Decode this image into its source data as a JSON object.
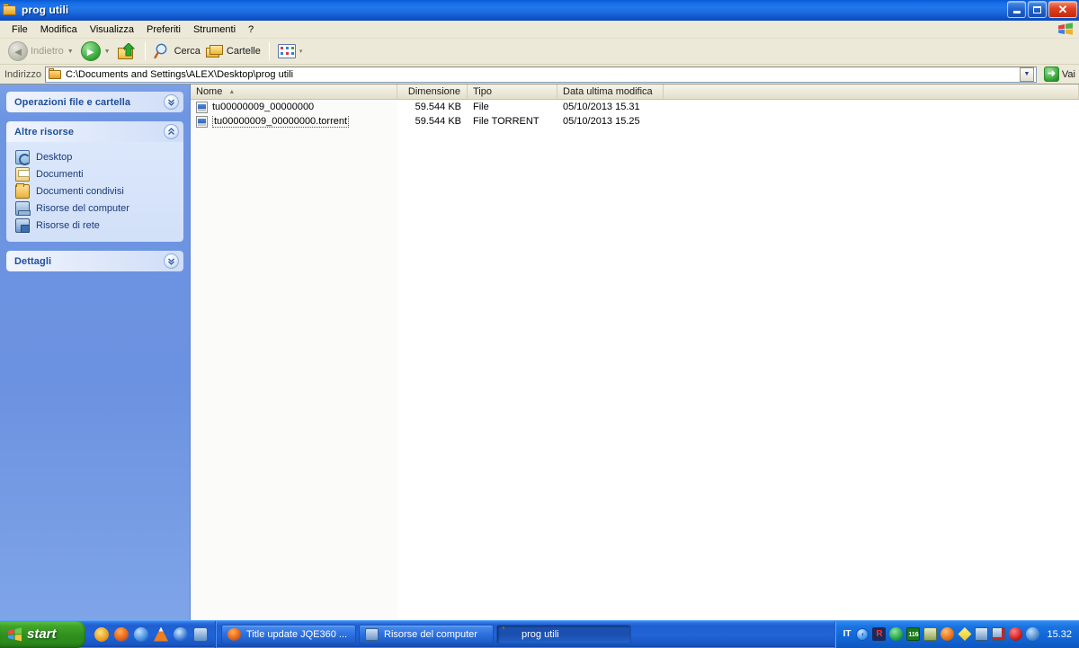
{
  "window": {
    "title": "prog utili",
    "title_icon": "folder-icon",
    "controls": {
      "minimize": "_",
      "maximize": "❐",
      "close": "✕"
    }
  },
  "menu": {
    "items": [
      {
        "label": "File"
      },
      {
        "label": "Modifica"
      },
      {
        "label": "Visualizza"
      },
      {
        "label": "Preferiti"
      },
      {
        "label": "Strumenti"
      },
      {
        "label": "?"
      }
    ],
    "right_logo": "windows-flag-icon"
  },
  "toolbar": {
    "back": {
      "label": "Indietro",
      "icon": "back-arrow-icon",
      "enabled": false
    },
    "forward": {
      "label": "",
      "icon": "forward-arrow-icon",
      "enabled": true
    },
    "up": {
      "label": "",
      "icon": "up-folder-icon"
    },
    "search": {
      "label": "Cerca",
      "icon": "magnifier-icon"
    },
    "folders": {
      "label": "Cartelle",
      "icon": "folders-icon"
    },
    "views": {
      "label": "",
      "icon": "views-grid-icon"
    },
    "dropdown_arrow": "▾"
  },
  "address": {
    "label": "Indirizzo",
    "icon": "folder-icon",
    "value": "C:\\Documents and Settings\\ALEX\\Desktop\\prog utili",
    "dropdown_icon": "chevron-down-icon",
    "go_label": "Vai",
    "go_icon": "go-arrow-icon"
  },
  "sidebar": {
    "panels": [
      {
        "title": "Operazioni file e cartella",
        "collapsed": true,
        "chevron": "⌄⌄",
        "items": []
      },
      {
        "title": "Altre risorse",
        "collapsed": false,
        "chevron": "⌃⌃",
        "items": [
          {
            "label": "Desktop",
            "icon": "desktop-icon"
          },
          {
            "label": "Documenti",
            "icon": "documents-icon"
          },
          {
            "label": "Documenti condivisi",
            "icon": "shared-documents-icon"
          },
          {
            "label": "Risorse del computer",
            "icon": "my-computer-icon"
          },
          {
            "label": "Risorse di rete",
            "icon": "network-places-icon"
          }
        ]
      },
      {
        "title": "Dettagli",
        "collapsed": true,
        "chevron": "⌄⌄",
        "items": []
      }
    ]
  },
  "filelist": {
    "columns": [
      {
        "key": "name",
        "label": "Nome",
        "sorted": true,
        "sort_arrow": "▲"
      },
      {
        "key": "size",
        "label": "Dimensione"
      },
      {
        "key": "type",
        "label": "Tipo"
      },
      {
        "key": "date",
        "label": "Data ultima modifica"
      }
    ],
    "rows": [
      {
        "icon": "file-icon",
        "name": "tu00000009_00000000",
        "size": "59.544 KB",
        "type": "File",
        "date": "05/10/2013 15.31",
        "focused": false
      },
      {
        "icon": "file-icon",
        "name": "tu00000009_00000000.torrent",
        "size": "59.544 KB",
        "type": "File TORRENT",
        "date": "05/10/2013 15.25",
        "focused": true
      }
    ]
  },
  "taskbar": {
    "start_label": "start",
    "start_icon": "windows-flag-icon",
    "quicklaunch": [
      {
        "icon": "emule-icon",
        "color": "#f0a82a"
      },
      {
        "icon": "firefox-icon",
        "color": "#e86c20"
      },
      {
        "icon": "internet-explorer-icon",
        "color": "#2f7fd8"
      },
      {
        "icon": "vlc-cone-icon",
        "color": "#ee8020"
      },
      {
        "icon": "media-player-icon",
        "color": "#2a6fd0"
      },
      {
        "icon": "show-desktop-icon",
        "color": "#3f7fc0"
      }
    ],
    "tasks": [
      {
        "label": "Title update JQE360 ...",
        "icon": "firefox-icon",
        "active": false
      },
      {
        "label": "Risorse del computer",
        "icon": "my-computer-icon",
        "active": false
      },
      {
        "label": "prog utili",
        "icon": "folder-icon",
        "active": true
      }
    ],
    "tray": {
      "language": "IT",
      "chevron": "‹",
      "icons": [
        {
          "icon": "keyboard-layout-icon",
          "color": "#d02020"
        },
        {
          "icon": "shield-green-icon",
          "color": "#1f9f3f"
        },
        {
          "icon": "counter-116-icon",
          "color": "#1a7a1a"
        },
        {
          "icon": "package-icon",
          "color": "#7f9f4f"
        },
        {
          "icon": "download-manager-icon",
          "color": "#e06a10"
        },
        {
          "icon": "utorrent-icon",
          "color": "#e8c820"
        },
        {
          "icon": "network-connected-icon",
          "color": "#5f8fc0"
        },
        {
          "icon": "network-disconnected-icon",
          "color": "#c02020"
        },
        {
          "icon": "antivirus-alert-icon",
          "color": "#cc1818"
        },
        {
          "icon": "globe-icon",
          "color": "#3f7fc8"
        }
      ],
      "clock": "15.32"
    }
  }
}
